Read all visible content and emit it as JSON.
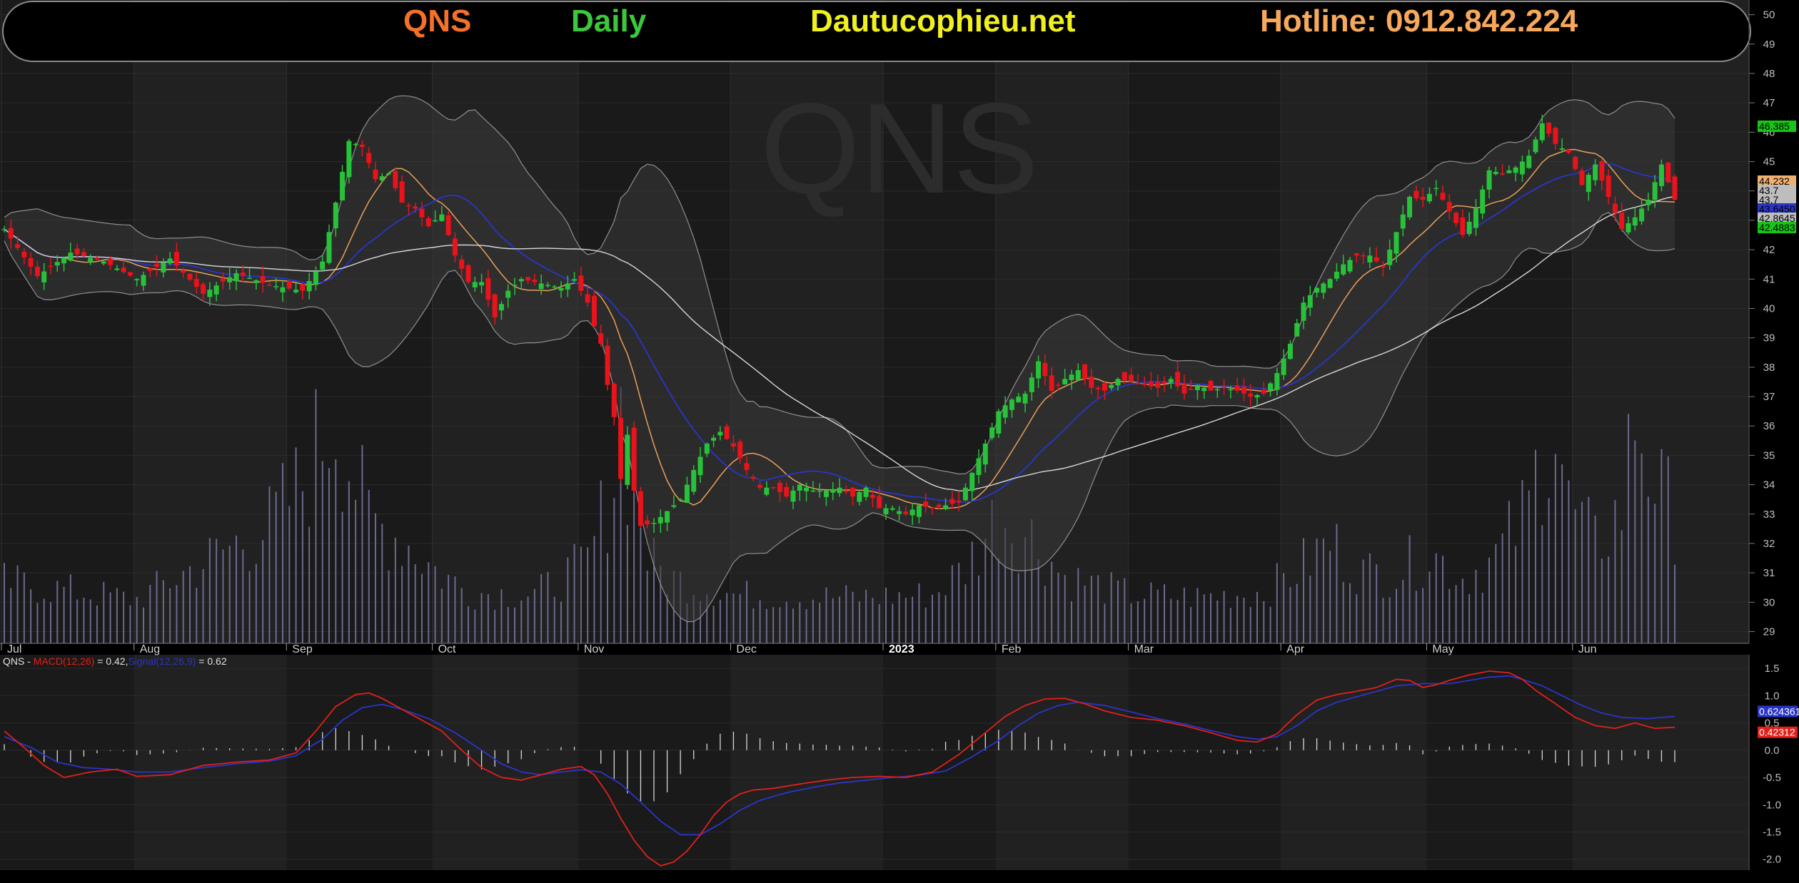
{
  "header": {
    "symbol": "QNS",
    "interval": "Daily",
    "site": "Dautucophieu.net",
    "hotline": "Hotline: 0912.842.224"
  },
  "watermark": "QNS",
  "colors": {
    "background": "#000000",
    "up": "#27c23a",
    "down": "#e8131b",
    "macd": "#e0201a",
    "signal": "#2a35c8",
    "ma_fast": "#e8a05a",
    "ma_slow": "#2a35c8",
    "ma_long": "#d8d8d8",
    "volume": "#6a6a90",
    "header_symbol": "#f4712a",
    "header_interval": "#3cc83c",
    "header_site": "#f0f020",
    "header_hotline": "#f6a85c"
  },
  "chart_data": [
    {
      "type": "candlestick",
      "name": "QNS",
      "x_labels": [
        "Jul",
        "Aug",
        "Sep",
        "Oct",
        "Nov",
        "Dec",
        "2023",
        "Feb",
        "Mar",
        "Apr",
        "May",
        "Jun"
      ],
      "month_start_bars": [
        0,
        20,
        43,
        65,
        87,
        110,
        133,
        150,
        170,
        193,
        215,
        237
      ],
      "ylim": [
        28.6,
        50.5
      ],
      "yticks": [
        29,
        30,
        31,
        32,
        33,
        34,
        35,
        36,
        37,
        38,
        39,
        40,
        41,
        42,
        43,
        44,
        45,
        46,
        47,
        48,
        49,
        50
      ],
      "close_path": [
        [
          0,
          42.7
        ],
        [
          5,
          41.1
        ],
        [
          10,
          41.9
        ],
        [
          15,
          41.6
        ],
        [
          20,
          41.0
        ],
        [
          25,
          41.7
        ],
        [
          30,
          40.5
        ],
        [
          35,
          41.2
        ],
        [
          40,
          40.8
        ],
        [
          45,
          40.6
        ],
        [
          48,
          41.6
        ],
        [
          50,
          43.6
        ],
        [
          52,
          45.7
        ],
        [
          54,
          45.5
        ],
        [
          56,
          44.4
        ],
        [
          58,
          44.6
        ],
        [
          60,
          43.6
        ],
        [
          62,
          43.4
        ],
        [
          64,
          42.8
        ],
        [
          66,
          43.2
        ],
        [
          68,
          41.8
        ],
        [
          70,
          40.9
        ],
        [
          72,
          40.9
        ],
        [
          74,
          39.7
        ],
        [
          76,
          40.6
        ],
        [
          78,
          41.0
        ],
        [
          80,
          40.9
        ],
        [
          82,
          40.8
        ],
        [
          84,
          40.7
        ],
        [
          86,
          41.0
        ],
        [
          88,
          40.2
        ],
        [
          89,
          39.4
        ],
        [
          90,
          38.8
        ],
        [
          91,
          37.4
        ],
        [
          92,
          36.3
        ],
        [
          93,
          34.2
        ],
        [
          94,
          35.7
        ],
        [
          95,
          33.8
        ],
        [
          96,
          32.6
        ],
        [
          98,
          32.7
        ],
        [
          100,
          33.1
        ],
        [
          102,
          33.5
        ],
        [
          104,
          34.5
        ],
        [
          106,
          35.4
        ],
        [
          108,
          35.8
        ],
        [
          110,
          35.3
        ],
        [
          112,
          34.5
        ],
        [
          114,
          33.9
        ],
        [
          116,
          33.9
        ],
        [
          118,
          33.6
        ],
        [
          120,
          34.0
        ],
        [
          122,
          33.8
        ],
        [
          124,
          33.8
        ],
        [
          126,
          33.9
        ],
        [
          128,
          33.6
        ],
        [
          130,
          33.9
        ],
        [
          132,
          33.2
        ],
        [
          134,
          33.2
        ],
        [
          136,
          33.0
        ],
        [
          138,
          33.3
        ],
        [
          140,
          33.2
        ],
        [
          142,
          33.3
        ],
        [
          144,
          33.4
        ],
        [
          146,
          34.4
        ],
        [
          148,
          35.4
        ],
        [
          150,
          36.5
        ],
        [
          152,
          36.9
        ],
        [
          154,
          37.1
        ],
        [
          156,
          38.2
        ],
        [
          158,
          37.2
        ],
        [
          160,
          37.6
        ],
        [
          162,
          37.9
        ],
        [
          164,
          37.3
        ],
        [
          166,
          37.2
        ],
        [
          168,
          37.6
        ],
        [
          170,
          37.5
        ],
        [
          172,
          37.4
        ],
        [
          174,
          37.3
        ],
        [
          176,
          37.6
        ],
        [
          178,
          37.1
        ],
        [
          180,
          37.4
        ],
        [
          182,
          37.2
        ],
        [
          184,
          37.3
        ],
        [
          186,
          37.2
        ],
        [
          188,
          37.0
        ],
        [
          190,
          37.1
        ],
        [
          192,
          37.8
        ],
        [
          194,
          38.8
        ],
        [
          196,
          40.2
        ],
        [
          198,
          40.7
        ],
        [
          200,
          41.0
        ],
        [
          202,
          41.5
        ],
        [
          204,
          41.8
        ],
        [
          206,
          41.8
        ],
        [
          208,
          41.4
        ],
        [
          210,
          42.6
        ],
        [
          212,
          43.8
        ],
        [
          214,
          43.7
        ],
        [
          216,
          44.1
        ],
        [
          218,
          43.3
        ],
        [
          220,
          42.5
        ],
        [
          222,
          43.4
        ],
        [
          224,
          44.7
        ],
        [
          226,
          44.6
        ],
        [
          228,
          44.8
        ],
        [
          230,
          45.2
        ],
        [
          232,
          46.3
        ],
        [
          234,
          45.6
        ],
        [
          236,
          45.3
        ],
        [
          238,
          44.2
        ],
        [
          240,
          44.9
        ],
        [
          242,
          43.8
        ],
        [
          244,
          42.7
        ],
        [
          246,
          43.1
        ],
        [
          248,
          43.7
        ],
        [
          250,
          44.9
        ],
        [
          252,
          43.7
        ]
      ],
      "volume_envelope": [
        [
          0,
          2.0
        ],
        [
          20,
          1.3
        ],
        [
          30,
          2.8
        ],
        [
          40,
          4.3
        ],
        [
          45,
          6.0
        ],
        [
          48,
          8.0
        ],
        [
          50,
          9.0
        ],
        [
          52,
          7.0
        ],
        [
          55,
          4.5
        ],
        [
          60,
          3.8
        ],
        [
          65,
          2.5
        ],
        [
          70,
          1.6
        ],
        [
          80,
          1.5
        ],
        [
          88,
          2.8
        ],
        [
          90,
          4.5
        ],
        [
          92,
          6.5
        ],
        [
          93,
          9.0
        ],
        [
          94,
          7.0
        ],
        [
          95,
          6.5
        ],
        [
          97,
          3.0
        ],
        [
          100,
          2.2
        ],
        [
          110,
          1.5
        ],
        [
          120,
          1.4
        ],
        [
          130,
          1.4
        ],
        [
          140,
          1.5
        ],
        [
          145,
          2.6
        ],
        [
          150,
          4.8
        ],
        [
          155,
          3.8
        ],
        [
          160,
          2.2
        ],
        [
          170,
          1.5
        ],
        [
          180,
          1.4
        ],
        [
          190,
          1.6
        ],
        [
          195,
          2.5
        ],
        [
          200,
          3.6
        ],
        [
          205,
          2.4
        ],
        [
          210,
          2.4
        ],
        [
          215,
          3.2
        ],
        [
          220,
          2.2
        ],
        [
          225,
          3.0
        ],
        [
          230,
          5.0
        ],
        [
          232,
          7.5
        ],
        [
          234,
          8.5
        ],
        [
          236,
          5.0
        ],
        [
          240,
          3.5
        ],
        [
          244,
          5.0
        ],
        [
          246,
          9.0
        ],
        [
          248,
          7.0
        ],
        [
          250,
          5.4
        ],
        [
          252,
          4.8
        ]
      ],
      "last_value_tags": [
        {
          "value": "46.385",
          "color": "#17c417"
        },
        {
          "value": "44.232",
          "color": "#f0b070"
        },
        {
          "value": "43.7",
          "color": "#bdbdbd"
        },
        {
          "value": "43.7",
          "color": "#bdbdbd"
        },
        {
          "value": "43.6450",
          "color": "#2a35c8"
        },
        {
          "value": "42.8645",
          "color": "#bdbdbd"
        },
        {
          "value": "42.4883",
          "color": "#17c417"
        }
      ]
    },
    {
      "type": "line",
      "name": "MACD",
      "legend_prefix": "QNS - ",
      "legend_macd": "MACD(12,26)",
      "legend_macd_val": " = 0.42,",
      "legend_signal": "Signal(12,26,9)",
      "legend_signal_val": " = 0.62",
      "ylim": [
        -2.2,
        1.75
      ],
      "yticks": [
        1.5,
        1.0,
        0.5,
        0.0,
        -0.5,
        -1.0,
        -1.5,
        -2.0
      ],
      "ytick_labels": [
        "1.5",
        "1.0",
        "0.5",
        "0.0",
        "-0.5",
        "-1.0",
        "-1.5",
        "-2.0"
      ],
      "macd_path": [
        [
          0,
          0.35
        ],
        [
          3,
          0.05
        ],
        [
          6,
          -0.28
        ],
        [
          9,
          -0.5
        ],
        [
          13,
          -0.4
        ],
        [
          17,
          -0.35
        ],
        [
          20,
          -0.48
        ],
        [
          25,
          -0.45
        ],
        [
          30,
          -0.28
        ],
        [
          35,
          -0.22
        ],
        [
          40,
          -0.18
        ],
        [
          44,
          -0.05
        ],
        [
          47,
          0.35
        ],
        [
          50,
          0.8
        ],
        [
          53,
          1.02
        ],
        [
          55,
          1.05
        ],
        [
          57,
          0.95
        ],
        [
          60,
          0.75
        ],
        [
          63,
          0.55
        ],
        [
          66,
          0.35
        ],
        [
          69,
          0.0
        ],
        [
          72,
          -0.32
        ],
        [
          75,
          -0.5
        ],
        [
          78,
          -0.55
        ],
        [
          81,
          -0.45
        ],
        [
          84,
          -0.35
        ],
        [
          87,
          -0.3
        ],
        [
          89,
          -0.45
        ],
        [
          91,
          -0.8
        ],
        [
          93,
          -1.25
        ],
        [
          95,
          -1.65
        ],
        [
          97,
          -1.95
        ],
        [
          99,
          -2.12
        ],
        [
          101,
          -2.05
        ],
        [
          103,
          -1.85
        ],
        [
          105,
          -1.55
        ],
        [
          107,
          -1.2
        ],
        [
          109,
          -0.95
        ],
        [
          111,
          -0.8
        ],
        [
          113,
          -0.73
        ],
        [
          116,
          -0.7
        ],
        [
          120,
          -0.62
        ],
        [
          124,
          -0.55
        ],
        [
          128,
          -0.5
        ],
        [
          132,
          -0.48
        ],
        [
          136,
          -0.5
        ],
        [
          140,
          -0.4
        ],
        [
          144,
          -0.08
        ],
        [
          148,
          0.32
        ],
        [
          151,
          0.62
        ],
        [
          154,
          0.82
        ],
        [
          157,
          0.94
        ],
        [
          160,
          0.95
        ],
        [
          163,
          0.85
        ],
        [
          166,
          0.72
        ],
        [
          170,
          0.6
        ],
        [
          174,
          0.55
        ],
        [
          178,
          0.45
        ],
        [
          182,
          0.32
        ],
        [
          186,
          0.18
        ],
        [
          189,
          0.15
        ],
        [
          192,
          0.3
        ],
        [
          195,
          0.65
        ],
        [
          198,
          0.92
        ],
        [
          201,
          1.02
        ],
        [
          204,
          1.08
        ],
        [
          207,
          1.15
        ],
        [
          210,
          1.3
        ],
        [
          212,
          1.28
        ],
        [
          214,
          1.15
        ],
        [
          216,
          1.2
        ],
        [
          218,
          1.28
        ],
        [
          221,
          1.38
        ],
        [
          224,
          1.45
        ],
        [
          227,
          1.42
        ],
        [
          229,
          1.3
        ],
        [
          231,
          1.1
        ],
        [
          234,
          0.85
        ],
        [
          237,
          0.6
        ],
        [
          240,
          0.45
        ],
        [
          243,
          0.4
        ],
        [
          246,
          0.5
        ],
        [
          249,
          0.4
        ],
        [
          252,
          0.42
        ]
      ],
      "signal_path": [
        [
          0,
          0.25
        ],
        [
          4,
          0.05
        ],
        [
          8,
          -0.22
        ],
        [
          12,
          -0.32
        ],
        [
          16,
          -0.35
        ],
        [
          20,
          -0.4
        ],
        [
          25,
          -0.4
        ],
        [
          30,
          -0.32
        ],
        [
          35,
          -0.25
        ],
        [
          40,
          -0.2
        ],
        [
          44,
          -0.1
        ],
        [
          48,
          0.2
        ],
        [
          51,
          0.55
        ],
        [
          54,
          0.78
        ],
        [
          57,
          0.84
        ],
        [
          60,
          0.75
        ],
        [
          64,
          0.58
        ],
        [
          68,
          0.32
        ],
        [
          72,
          0.0
        ],
        [
          75,
          -0.25
        ],
        [
          78,
          -0.4
        ],
        [
          81,
          -0.45
        ],
        [
          84,
          -0.4
        ],
        [
          87,
          -0.36
        ],
        [
          90,
          -0.4
        ],
        [
          93,
          -0.62
        ],
        [
          96,
          -0.95
        ],
        [
          99,
          -1.3
        ],
        [
          102,
          -1.55
        ],
        [
          105,
          -1.55
        ],
        [
          108,
          -1.35
        ],
        [
          111,
          -1.1
        ],
        [
          114,
          -0.92
        ],
        [
          118,
          -0.78
        ],
        [
          122,
          -0.68
        ],
        [
          126,
          -0.6
        ],
        [
          130,
          -0.55
        ],
        [
          134,
          -0.5
        ],
        [
          138,
          -0.46
        ],
        [
          142,
          -0.38
        ],
        [
          146,
          -0.12
        ],
        [
          150,
          0.18
        ],
        [
          153,
          0.45
        ],
        [
          156,
          0.68
        ],
        [
          159,
          0.82
        ],
        [
          162,
          0.88
        ],
        [
          166,
          0.82
        ],
        [
          170,
          0.7
        ],
        [
          174,
          0.58
        ],
        [
          178,
          0.48
        ],
        [
          182,
          0.36
        ],
        [
          186,
          0.25
        ],
        [
          189,
          0.2
        ],
        [
          192,
          0.25
        ],
        [
          195,
          0.45
        ],
        [
          198,
          0.72
        ],
        [
          201,
          0.88
        ],
        [
          204,
          0.98
        ],
        [
          207,
          1.08
        ],
        [
          210,
          1.18
        ],
        [
          214,
          1.22
        ],
        [
          218,
          1.22
        ],
        [
          221,
          1.28
        ],
        [
          224,
          1.34
        ],
        [
          227,
          1.36
        ],
        [
          229,
          1.3
        ],
        [
          232,
          1.18
        ],
        [
          235,
          1.0
        ],
        [
          238,
          0.82
        ],
        [
          241,
          0.68
        ],
        [
          244,
          0.6
        ],
        [
          248,
          0.58
        ],
        [
          252,
          0.62
        ]
      ],
      "last_value_tags": [
        {
          "value": "0.624361",
          "color": "#2a35c8"
        },
        {
          "value": "0.42312",
          "color": "#e0201a"
        }
      ]
    }
  ]
}
